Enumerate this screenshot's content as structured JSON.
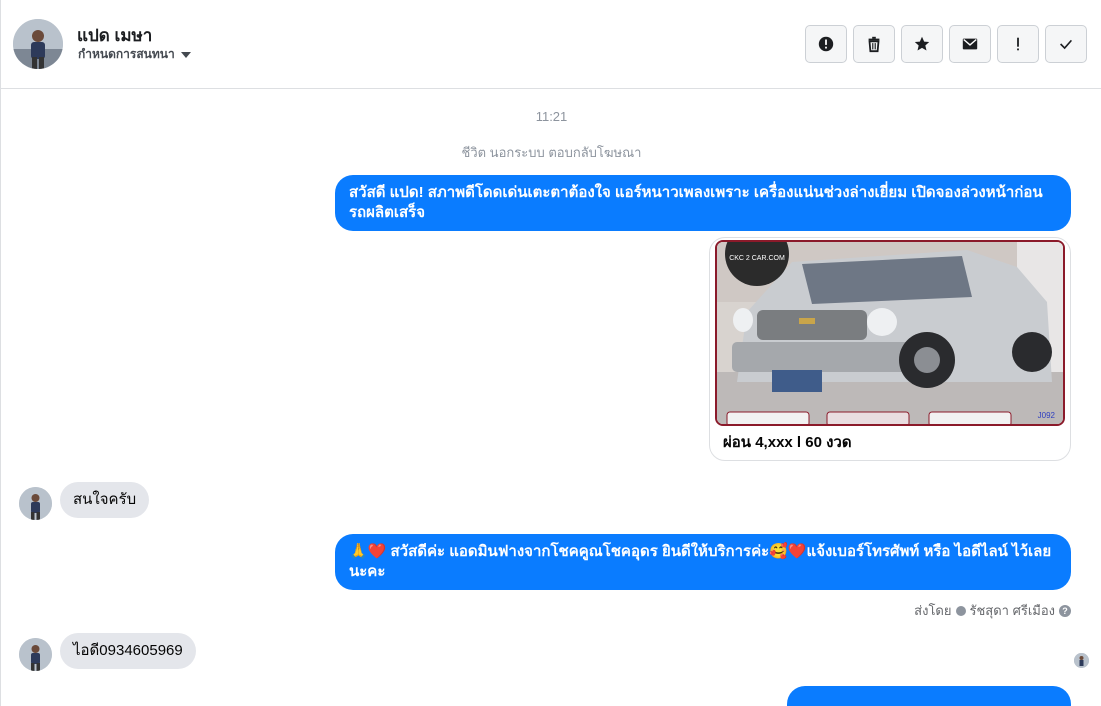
{
  "header": {
    "name": "แปด เมษา",
    "subtitle": "กำหนดการสนทนา",
    "toolbar": [
      {
        "icon": "alert-circle-icon"
      },
      {
        "icon": "trash-icon"
      },
      {
        "icon": "star-icon"
      },
      {
        "icon": "envelope-icon"
      },
      {
        "icon": "exclamation-icon"
      },
      {
        "icon": "check-icon"
      }
    ]
  },
  "thread": {
    "timestamp": "11:21",
    "system_note": "ชีวิต นอกระบบ ตอบกลับโฆษณา",
    "messages": [
      {
        "dir": "out",
        "text": "สวัสดี แปด! สภาพดีโดดเด่นเตะตาต้องใจ แอร์หนาวเพลงเพราะ เครื่องแน่นช่วงล่างเยี่ยม เปิดจองล่วงหน้าก่อนรถผลิตเสร็จ"
      },
      {
        "dir": "out",
        "type": "card",
        "caption": "ผ่อน 4,xxx l 60 งวด",
        "watermark": "CKC 2 CAR.COM",
        "stock_code": "J092"
      },
      {
        "dir": "in",
        "text": "สนใจครับ"
      },
      {
        "dir": "out",
        "text": "🙏❤️ สวัสดีค่ะ แอดมินฟางจากโชคคูณโชคอุดร ยินดีให้บริการค่ะ🥰❤️แจ้งเบอร์โทรศัพท์ หรือ ไอดีไลน์  ไว้เลยนะคะ"
      },
      {
        "dir": "in",
        "text": "ไอดี0934605969"
      }
    ],
    "sent_by_label": "ส่งโดย",
    "sent_by_name": "รัชสุดา ศรีเมือง"
  },
  "colors": {
    "outgoing_bubble": "#0a7cff",
    "incoming_bubble": "#e4e6eb",
    "muted_text": "#8d949e"
  }
}
